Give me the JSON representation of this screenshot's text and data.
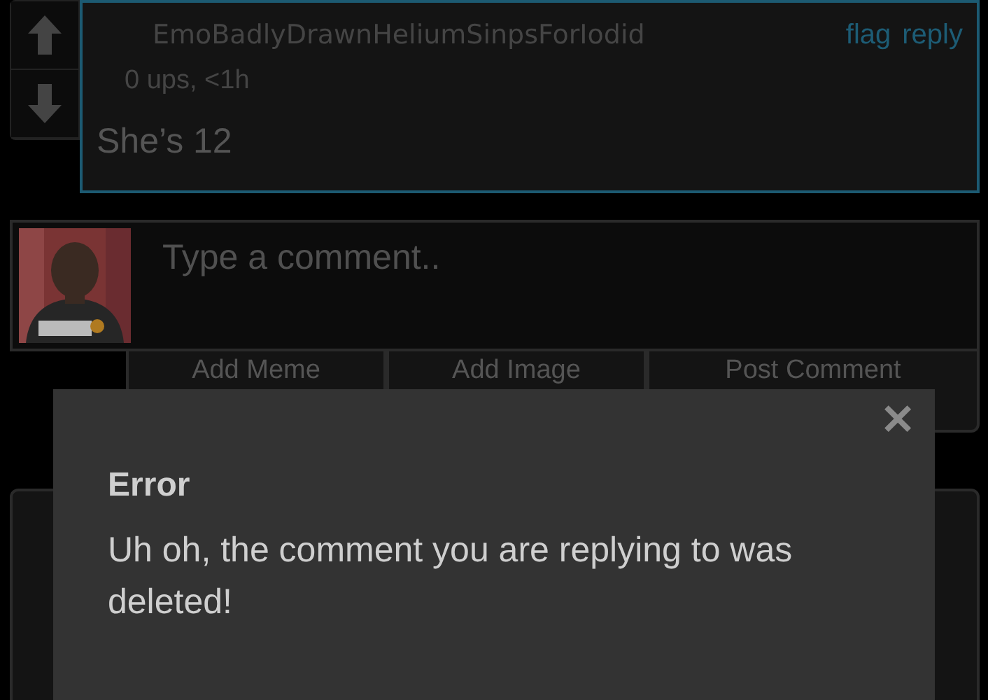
{
  "comment": {
    "username": "EmoBadlyDrawnHeliumSinpsForIodid",
    "actions": [
      "flag",
      "reply"
    ],
    "meta": "0 ups, <1h",
    "text": "She’s 12"
  },
  "composer": {
    "placeholder": "Type a comment..",
    "buttons": [
      "Add Meme",
      "Add Image",
      "Post Comment"
    ]
  },
  "dialog": {
    "close": "✕",
    "title": "Error",
    "message": "Uh oh, the comment you are replying to was deleted!"
  }
}
